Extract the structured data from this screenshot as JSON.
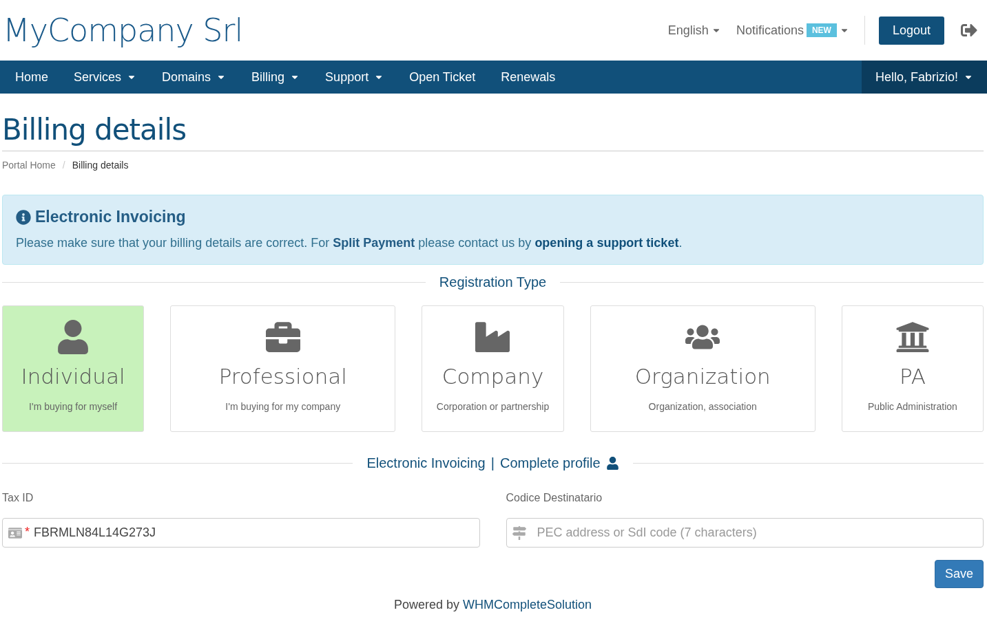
{
  "header": {
    "logo": "MyCompany Srl",
    "language": "English",
    "notifications": {
      "label": "Notifications",
      "badge": "NEW"
    },
    "logout": "Logout"
  },
  "nav": {
    "items": [
      {
        "label": "Home",
        "dropdown": false
      },
      {
        "label": "Services",
        "dropdown": true
      },
      {
        "label": "Domains",
        "dropdown": true
      },
      {
        "label": "Billing",
        "dropdown": true
      },
      {
        "label": "Support",
        "dropdown": true
      },
      {
        "label": "Open Ticket",
        "dropdown": false
      },
      {
        "label": "Renewals",
        "dropdown": false
      }
    ],
    "user": "Hello, Fabrizio!"
  },
  "page_title": "Billing details",
  "breadcrumb_separator": "/",
  "breadcrumb": [
    {
      "label": "Portal Home",
      "selected": false
    },
    {
      "label": "Billing details",
      "selected": true
    }
  ],
  "alert": {
    "title": "Electronic Invoicing",
    "text": "Please make sure that your billing details are correct. For **Split Payment** please contact us by",
    "link": "opening a support ticket",
    "text_end": "."
  },
  "registration": {
    "heading": "Registration Type",
    "types": [
      {
        "kind": "individual",
        "title": "Individual",
        "subtitle": "I'm buying for myself",
        "selected": true
      },
      {
        "kind": "professional",
        "title": "Professional",
        "subtitle": "I'm buying for my company",
        "selected": false
      },
      {
        "kind": "company",
        "title": "Company",
        "subtitle": "Corporation or partnership",
        "selected": false
      },
      {
        "kind": "organization",
        "title": "Organization",
        "subtitle": "Organization, association",
        "selected": false
      },
      {
        "kind": "pa",
        "title": "PA",
        "subtitle": "Public Administration",
        "selected": false
      }
    ]
  },
  "einvoicing": {
    "heading": "Electronic Invoicing",
    "separator": "|",
    "required_mark": "*",
    "link": "Complete profile",
    "fields": [
      {
        "kind": "taxid",
        "label": "Tax ID",
        "required": true,
        "value": "FBRMLN84L14G273J"
      },
      {
        "kind": "code",
        "label": "Codice Destinatario",
        "required": false,
        "placeholder": "PEC address or SdI code (7 characters)"
      }
    ],
    "save": "Save"
  },
  "footer": {
    "text": "Powered by",
    "link": "WHMCompleteSolution"
  }
}
